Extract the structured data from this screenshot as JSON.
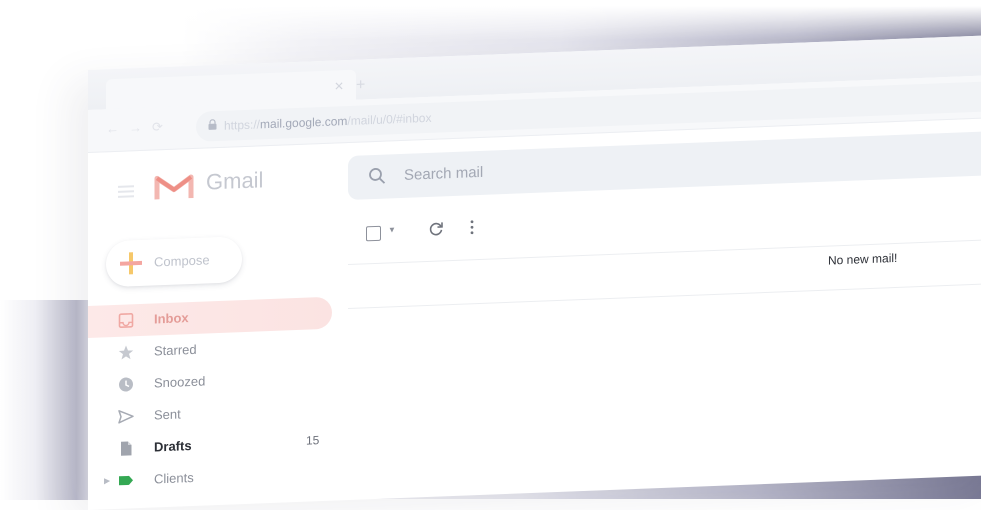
{
  "browser": {
    "url_prefix": "https://",
    "url_host": "mail.google.com",
    "url_path": "/mail/u/0/#inbox"
  },
  "app": {
    "name": "Gmail"
  },
  "search": {
    "placeholder": "Search mail"
  },
  "compose": {
    "label": "Compose"
  },
  "sidebar": {
    "items": [
      {
        "label": "Inbox",
        "icon": "inbox-icon",
        "active": true
      },
      {
        "label": "Starred",
        "icon": "star-icon"
      },
      {
        "label": "Snoozed",
        "icon": "clock-icon"
      },
      {
        "label": "Sent",
        "icon": "send-icon"
      },
      {
        "label": "Drafts",
        "icon": "draft-icon",
        "count": "15"
      },
      {
        "label": "Clients",
        "icon": "label-icon"
      }
    ]
  },
  "mail_list": {
    "empty_message": "No new mail!"
  },
  "colors": {
    "label_clients": "#34a853",
    "gmail_red": "#ea4335",
    "compose_plus": "#fbbc04"
  }
}
